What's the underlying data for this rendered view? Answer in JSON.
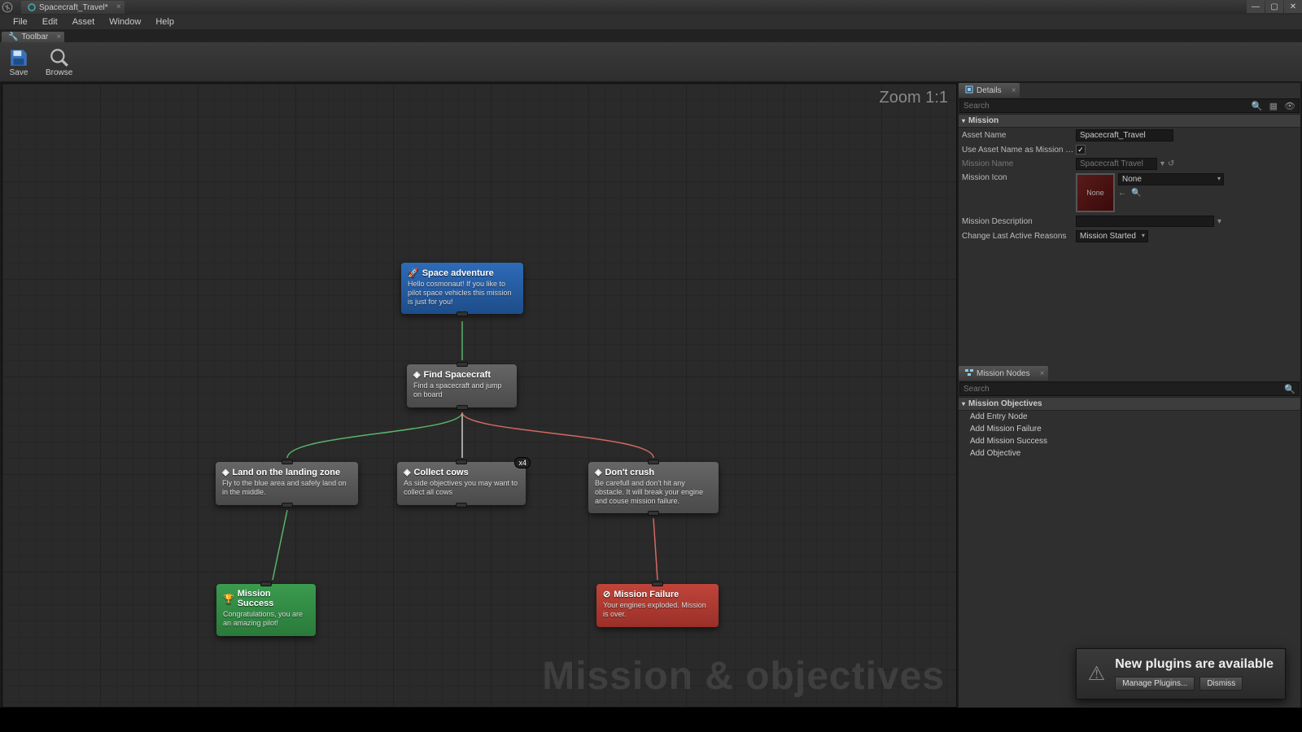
{
  "titlebar": {
    "tab_label": "Spacecraft_Travel*"
  },
  "menus": [
    "File",
    "Edit",
    "Asset",
    "Window",
    "Help"
  ],
  "toolbar_tab": "Toolbar",
  "toolbar": {
    "save": "Save",
    "browse": "Browse"
  },
  "graph": {
    "zoom": "Zoom 1:1",
    "watermark": "Mission & objectives",
    "nodes": {
      "entry": {
        "title": "Space adventure",
        "desc": "Hello cosmonaut!\nIf you like to pilot space vehicles this mission is just for you!"
      },
      "find": {
        "title": "Find Spacecraft",
        "desc": "Find a spacecraft and jump on board"
      },
      "land": {
        "title": "Land on the landing zone",
        "desc": "Fly to the blue area and safely land on in the middle."
      },
      "cows": {
        "title": "Collect cows",
        "desc": "As side objectives you may want to collect all cows",
        "badge": "x4"
      },
      "crush": {
        "title": "Don't crush",
        "desc": "Be carefull and don't hit any obstacle. It will break your engine and couse mission failure."
      },
      "success": {
        "title": "Mission Success",
        "desc": "Congratulations, you are an amazing pilot!"
      },
      "failure": {
        "title": "Mission Failure",
        "desc": "Your engines exploded. Mission is over."
      }
    }
  },
  "details": {
    "panel_title": "Details",
    "search_placeholder": "Search",
    "section": "Mission",
    "asset_name_label": "Asset Name",
    "asset_name_value": "Spacecraft_Travel",
    "use_asset_name_label": "Use Asset Name as Mission Na",
    "use_asset_name_checked": "✓",
    "mission_name_label": "Mission Name",
    "mission_name_value": "Spacecraft Travel",
    "mission_icon_label": "Mission Icon",
    "mission_icon_thumb": "None",
    "mission_icon_dropdown": "None",
    "mission_desc_label": "Mission Description",
    "mission_desc_value": "",
    "change_reason_label": "Change Last Active Reasons",
    "change_reason_value": "Mission Started"
  },
  "mission_nodes": {
    "panel_title": "Mission Nodes",
    "search_placeholder": "Search",
    "section": "Mission Objectives",
    "items": [
      "Add Entry Node",
      "Add Mission Failure",
      "Add Mission Success",
      "Add Objective"
    ]
  },
  "notification": {
    "header": "New plugins are available",
    "manage": "Manage Plugins...",
    "dismiss": "Dismiss"
  }
}
